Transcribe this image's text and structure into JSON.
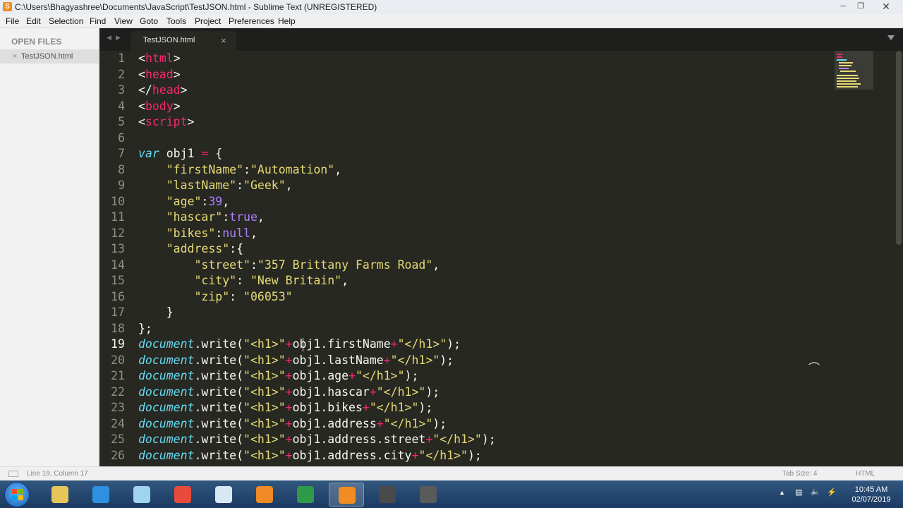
{
  "window": {
    "title": "C:\\Users\\Bhagyashree\\Documents\\JavaScript\\TestJSON.html - Sublime Text (UNREGISTERED)"
  },
  "menu": [
    "File",
    "Edit",
    "Selection",
    "Find",
    "View",
    "Goto",
    "Tools",
    "Project",
    "Preferences",
    "Help"
  ],
  "sidebar": {
    "header": "OPEN FILES",
    "files": [
      {
        "name": "TestJSON.html",
        "close": "×"
      }
    ]
  },
  "tabs": [
    {
      "label": "TestJSON.html",
      "close": "×"
    }
  ],
  "editor": {
    "current_line": 19,
    "lines": [
      {
        "n": "1",
        "segs": [
          {
            "t": "<",
            "c": ""
          },
          {
            "t": "html",
            "c": "tg"
          },
          {
            "t": ">",
            "c": ""
          }
        ]
      },
      {
        "n": "2",
        "segs": [
          {
            "t": "<",
            "c": ""
          },
          {
            "t": "head",
            "c": "tg"
          },
          {
            "t": ">",
            "c": ""
          }
        ]
      },
      {
        "n": "3",
        "segs": [
          {
            "t": "</",
            "c": ""
          },
          {
            "t": "head",
            "c": "tg"
          },
          {
            "t": ">",
            "c": ""
          }
        ]
      },
      {
        "n": "4",
        "segs": [
          {
            "t": "<",
            "c": ""
          },
          {
            "t": "body",
            "c": "tg"
          },
          {
            "t": ">",
            "c": ""
          }
        ]
      },
      {
        "n": "5",
        "segs": [
          {
            "t": "<",
            "c": ""
          },
          {
            "t": "script",
            "c": "tg"
          },
          {
            "t": ">",
            "c": ""
          }
        ]
      },
      {
        "n": "6",
        "segs": []
      },
      {
        "n": "7",
        "segs": [
          {
            "t": "var",
            "c": "it"
          },
          {
            "t": " obj1 ",
            "c": ""
          },
          {
            "t": "=",
            "c": "op"
          },
          {
            "t": " {",
            "c": ""
          }
        ]
      },
      {
        "n": "8",
        "segs": [
          {
            "t": "    ",
            "c": ""
          },
          {
            "t": "\"firstName\"",
            "c": "st"
          },
          {
            "t": ":",
            "c": ""
          },
          {
            "t": "\"Automation\"",
            "c": "st"
          },
          {
            "t": ",",
            "c": ""
          }
        ]
      },
      {
        "n": "9",
        "segs": [
          {
            "t": "    ",
            "c": ""
          },
          {
            "t": "\"lastName\"",
            "c": "st"
          },
          {
            "t": ":",
            "c": ""
          },
          {
            "t": "\"Geek\"",
            "c": "st"
          },
          {
            "t": ",",
            "c": ""
          }
        ]
      },
      {
        "n": "10",
        "segs": [
          {
            "t": "    ",
            "c": ""
          },
          {
            "t": "\"age\"",
            "c": "st"
          },
          {
            "t": ":",
            "c": ""
          },
          {
            "t": "39",
            "c": "nm"
          },
          {
            "t": ",",
            "c": ""
          }
        ]
      },
      {
        "n": "11",
        "segs": [
          {
            "t": "    ",
            "c": ""
          },
          {
            "t": "\"hascar\"",
            "c": "st"
          },
          {
            "t": ":",
            "c": ""
          },
          {
            "t": "true",
            "c": "kw"
          },
          {
            "t": ",",
            "c": ""
          }
        ]
      },
      {
        "n": "12",
        "segs": [
          {
            "t": "    ",
            "c": ""
          },
          {
            "t": "\"bikes\"",
            "c": "st"
          },
          {
            "t": ":",
            "c": ""
          },
          {
            "t": "null",
            "c": "kw"
          },
          {
            "t": ",",
            "c": ""
          }
        ]
      },
      {
        "n": "13",
        "segs": [
          {
            "t": "    ",
            "c": ""
          },
          {
            "t": "\"address\"",
            "c": "st"
          },
          {
            "t": ":{",
            "c": ""
          }
        ]
      },
      {
        "n": "14",
        "segs": [
          {
            "t": "        ",
            "c": ""
          },
          {
            "t": "\"street\"",
            "c": "st"
          },
          {
            "t": ":",
            "c": ""
          },
          {
            "t": "\"357 Brittany Farms Road\"",
            "c": "st"
          },
          {
            "t": ",",
            "c": ""
          }
        ]
      },
      {
        "n": "15",
        "segs": [
          {
            "t": "        ",
            "c": ""
          },
          {
            "t": "\"city\"",
            "c": "st"
          },
          {
            "t": ": ",
            "c": ""
          },
          {
            "t": "\"New Britain\"",
            "c": "st"
          },
          {
            "t": ",",
            "c": ""
          }
        ]
      },
      {
        "n": "16",
        "segs": [
          {
            "t": "        ",
            "c": ""
          },
          {
            "t": "\"zip\"",
            "c": "st"
          },
          {
            "t": ": ",
            "c": ""
          },
          {
            "t": "\"06053\"",
            "c": "st"
          }
        ]
      },
      {
        "n": "17",
        "segs": [
          {
            "t": "    }",
            "c": ""
          }
        ]
      },
      {
        "n": "18",
        "segs": [
          {
            "t": "};",
            "c": ""
          }
        ]
      },
      {
        "n": "19",
        "segs": [
          {
            "t": "document",
            "c": "it"
          },
          {
            "t": ".write(",
            "c": ""
          },
          {
            "t": "\"<h1>\"",
            "c": "st"
          },
          {
            "t": "+",
            "c": "op"
          },
          {
            "t": "obj1.firstName",
            "c": ""
          },
          {
            "t": "+",
            "c": "op"
          },
          {
            "t": "\"</h1>\"",
            "c": "st"
          },
          {
            "t": ");",
            "c": ""
          }
        ]
      },
      {
        "n": "20",
        "segs": [
          {
            "t": "document",
            "c": "it"
          },
          {
            "t": ".write(",
            "c": ""
          },
          {
            "t": "\"<h1>\"",
            "c": "st"
          },
          {
            "t": "+",
            "c": "op"
          },
          {
            "t": "obj1.lastName",
            "c": ""
          },
          {
            "t": "+",
            "c": "op"
          },
          {
            "t": "\"</h1>\"",
            "c": "st"
          },
          {
            "t": ");",
            "c": ""
          }
        ]
      },
      {
        "n": "21",
        "segs": [
          {
            "t": "document",
            "c": "it"
          },
          {
            "t": ".write(",
            "c": ""
          },
          {
            "t": "\"<h1>\"",
            "c": "st"
          },
          {
            "t": "+",
            "c": "op"
          },
          {
            "t": "obj1.age",
            "c": ""
          },
          {
            "t": "+",
            "c": "op"
          },
          {
            "t": "\"</h1>\"",
            "c": "st"
          },
          {
            "t": ");",
            "c": ""
          }
        ]
      },
      {
        "n": "22",
        "segs": [
          {
            "t": "document",
            "c": "it"
          },
          {
            "t": ".write(",
            "c": ""
          },
          {
            "t": "\"<h1>\"",
            "c": "st"
          },
          {
            "t": "+",
            "c": "op"
          },
          {
            "t": "obj1.hascar",
            "c": ""
          },
          {
            "t": "+",
            "c": "op"
          },
          {
            "t": "\"</h1>\"",
            "c": "st"
          },
          {
            "t": ");",
            "c": ""
          }
        ]
      },
      {
        "n": "23",
        "segs": [
          {
            "t": "document",
            "c": "it"
          },
          {
            "t": ".write(",
            "c": ""
          },
          {
            "t": "\"<h1>\"",
            "c": "st"
          },
          {
            "t": "+",
            "c": "op"
          },
          {
            "t": "obj1.bikes",
            "c": ""
          },
          {
            "t": "+",
            "c": "op"
          },
          {
            "t": "\"</h1>\"",
            "c": "st"
          },
          {
            "t": ");",
            "c": ""
          }
        ]
      },
      {
        "n": "24",
        "segs": [
          {
            "t": "document",
            "c": "it"
          },
          {
            "t": ".write(",
            "c": ""
          },
          {
            "t": "\"<h1>\"",
            "c": "st"
          },
          {
            "t": "+",
            "c": "op"
          },
          {
            "t": "obj1.address",
            "c": ""
          },
          {
            "t": "+",
            "c": "op"
          },
          {
            "t": "\"</h1>\"",
            "c": "st"
          },
          {
            "t": ");",
            "c": ""
          }
        ]
      },
      {
        "n": "25",
        "segs": [
          {
            "t": "document",
            "c": "it"
          },
          {
            "t": ".write(",
            "c": ""
          },
          {
            "t": "\"<h1>\"",
            "c": "st"
          },
          {
            "t": "+",
            "c": "op"
          },
          {
            "t": "obj1.address.street",
            "c": ""
          },
          {
            "t": "+",
            "c": "op"
          },
          {
            "t": "\"</h1>\"",
            "c": "st"
          },
          {
            "t": ");",
            "c": ""
          }
        ]
      },
      {
        "n": "26",
        "segs": [
          {
            "t": "document",
            "c": "it"
          },
          {
            "t": ".write(",
            "c": ""
          },
          {
            "t": "\"<h1>\"",
            "c": "st"
          },
          {
            "t": "+",
            "c": "op"
          },
          {
            "t": "obj1.address.city",
            "c": ""
          },
          {
            "t": "+",
            "c": "op"
          },
          {
            "t": "\"</h1>\"",
            "c": "st"
          },
          {
            "t": ");",
            "c": ""
          }
        ]
      }
    ]
  },
  "status": {
    "position": "Line 19, Column 17",
    "tab_size": "Tab Size: 4",
    "syntax": "HTML"
  },
  "taskbar": {
    "apps": [
      {
        "icon": "explorer-icon",
        "color": "#e8c55a",
        "active": false
      },
      {
        "icon": "internet-explorer-icon",
        "color": "#2f8fe0",
        "active": false
      },
      {
        "icon": "notepad-icon",
        "color": "#9fd3f0",
        "active": false
      },
      {
        "icon": "chrome-icon",
        "color": "#e84b3c",
        "active": false
      },
      {
        "icon": "paint-icon",
        "color": "#d9e7f5",
        "active": false
      },
      {
        "icon": "firefox-icon",
        "color": "#f08a24",
        "active": false
      },
      {
        "icon": "excel-icon",
        "color": "#2f9a49",
        "active": false
      },
      {
        "icon": "sublime-text-icon",
        "color": "#f28c22",
        "active": true
      },
      {
        "icon": "terminal-icon",
        "color": "#4a4a4a",
        "active": false
      },
      {
        "icon": "tool-icon",
        "color": "#5a5a5a",
        "active": false
      }
    ],
    "time": "10:45 AM",
    "date": "02/07/2019"
  },
  "colors": {
    "background": "#272822",
    "tag": "#f92672",
    "string": "#e6db74",
    "keyword_italic": "#66d9ef",
    "number": "#ae81ff"
  }
}
